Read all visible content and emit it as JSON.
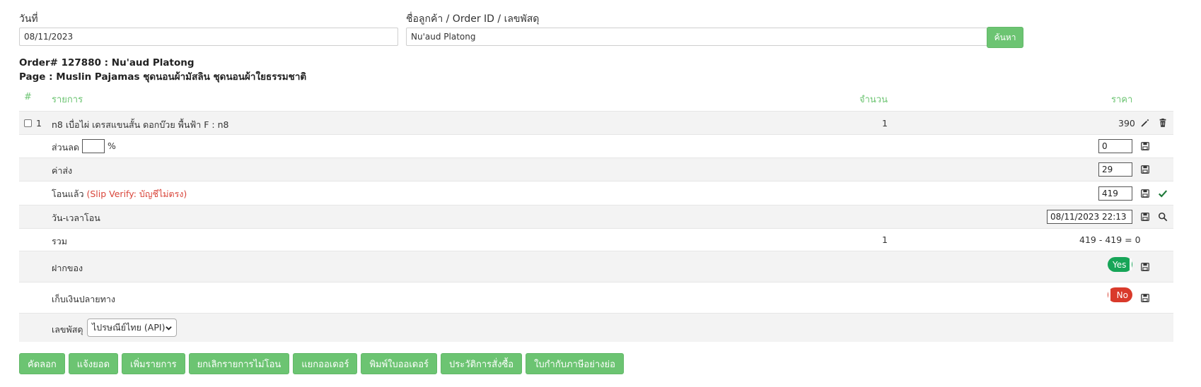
{
  "search": {
    "date_label": "วันที่",
    "date_value": "08/11/2023",
    "query_label": "ชื่อลูกค้า / Order ID / เลขพัสดุ",
    "query_value": "Nu'aud Platong",
    "search_button": "ค้นหา"
  },
  "order": {
    "title": "Order# 127880 : Nu'aud Platong",
    "page": "Page : Muslin Pajamas ชุดนอนผ้ามัสลิน ชุดนอนผ้าใยธรรมชาติ"
  },
  "table": {
    "headers": {
      "num": "#",
      "item": "รายการ",
      "qty": "จำนวน",
      "price": "ราคา"
    },
    "item": {
      "index": "1",
      "name": "n8 เบื่อไผ่ เดรสแขนสั้น ดอกบ๊วย พื้นฟ้า F : n8",
      "qty": "1",
      "price": "390"
    },
    "discount": {
      "label": "ส่วนลด",
      "percent_value": "",
      "percent_sign": "%",
      "value": "0"
    },
    "shipping": {
      "label": "ค่าส่ง",
      "value": "29"
    },
    "transferred": {
      "label": "โอนแล้ว",
      "note": "(Slip Verify: บัญชีไม่ตรง)",
      "value": "419"
    },
    "transfer_time": {
      "label": "วัน-เวลาโอน",
      "value": "08/11/2023 22:13"
    },
    "total": {
      "label": "รวม",
      "qty": "1",
      "formula": "419 - 419 = 0"
    },
    "deposit": {
      "label": "ฝากของ",
      "toggle": "Yes"
    },
    "cod": {
      "label": "เก็บเงินปลายทาง",
      "toggle": "No"
    },
    "tracking": {
      "label": "เลขพัสดุ",
      "carrier": "ไปรษณีย์ไทย (API)"
    }
  },
  "actions": [
    "คัดลอก",
    "แจ้งยอด",
    "เพิ่มรายการ",
    "ยกเลิกรายการไม่โอน",
    "แยกออเดอร์",
    "พิมพ์ใบออเดอร์",
    "ประวัติการสั่งซื้อ",
    "ใบกำกับภาษีอย่างย่อ"
  ],
  "colors": {
    "accent": "#6cc472",
    "yes": "#17a558",
    "no": "#d93a2b",
    "warning_text": "#d9453a"
  },
  "icons": [
    "pencil-icon",
    "trash-icon",
    "save-icon",
    "check-icon",
    "search-icon",
    "chevron-down-icon"
  ]
}
